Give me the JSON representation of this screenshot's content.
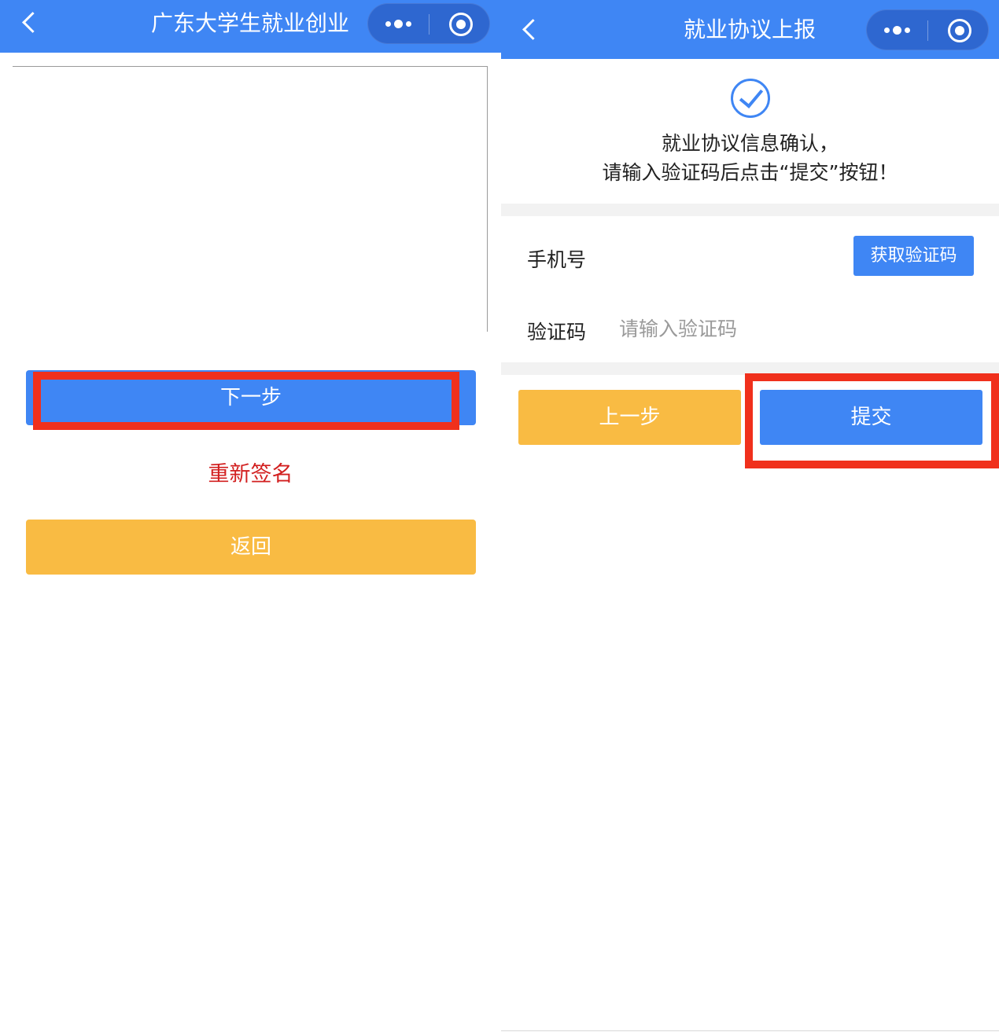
{
  "left": {
    "navbar": {
      "title": "广东大学生就业创业"
    },
    "buttons": {
      "next_label": "下一步",
      "resign_label": "重新签名",
      "back_label": "返回"
    }
  },
  "right": {
    "navbar": {
      "title": "就业协议上报"
    },
    "notice": {
      "line1": "就业协议信息确认，",
      "line2": "请输入验证码后点击“提交”按钮！"
    },
    "form": {
      "phone_label": "手机号",
      "get_code_label": "获取验证码",
      "code_label": "验证码",
      "code_placeholder": "请输入验证码",
      "code_value": ""
    },
    "buttons": {
      "prev_label": "上一步",
      "submit_label": "提交"
    }
  },
  "colors": {
    "brand_blue": "#3f86f4",
    "button_yellow": "#f9bb43",
    "highlight_red": "#f0301c",
    "resign_red": "#d21f1f"
  },
  "icons": [
    "back-icon",
    "more-icon",
    "target-icon",
    "check-circle-icon"
  ]
}
